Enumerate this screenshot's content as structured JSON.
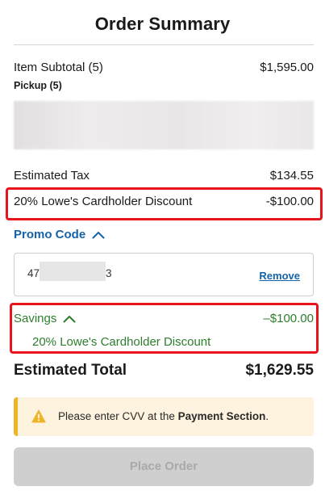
{
  "summary": {
    "title": "Order Summary",
    "item_subtotal_label": "Item Subtotal (5)",
    "item_subtotal_value": "$1,595.00",
    "pickup_label": "Pickup (5)",
    "estimated_tax_label": "Estimated Tax",
    "estimated_tax_value": "$134.55",
    "cardholder_discount_label": "20% Lowe's Cardholder Discount",
    "cardholder_discount_value": "-$100.00"
  },
  "promo": {
    "label": "Promo Code",
    "code_prefix": "47",
    "code_suffix": "3",
    "remove_label": "Remove"
  },
  "savings": {
    "label": "Savings",
    "value": "–$100.00",
    "detail": "20% Lowe's Cardholder Discount"
  },
  "total": {
    "label": "Estimated Total",
    "value": "$1,629.55"
  },
  "alert": {
    "text_before": "Please enter CVV at the ",
    "text_bold": "Payment Section",
    "text_after": "."
  },
  "actions": {
    "place_order_label": "Place Order"
  },
  "colors": {
    "link_blue": "#1463a8",
    "savings_green": "#2d7d2d",
    "highlight_red": "#e8141c",
    "alert_bg": "#fdf3df",
    "alert_accent": "#f0b429",
    "disabled_button": "#cfcfcf"
  }
}
